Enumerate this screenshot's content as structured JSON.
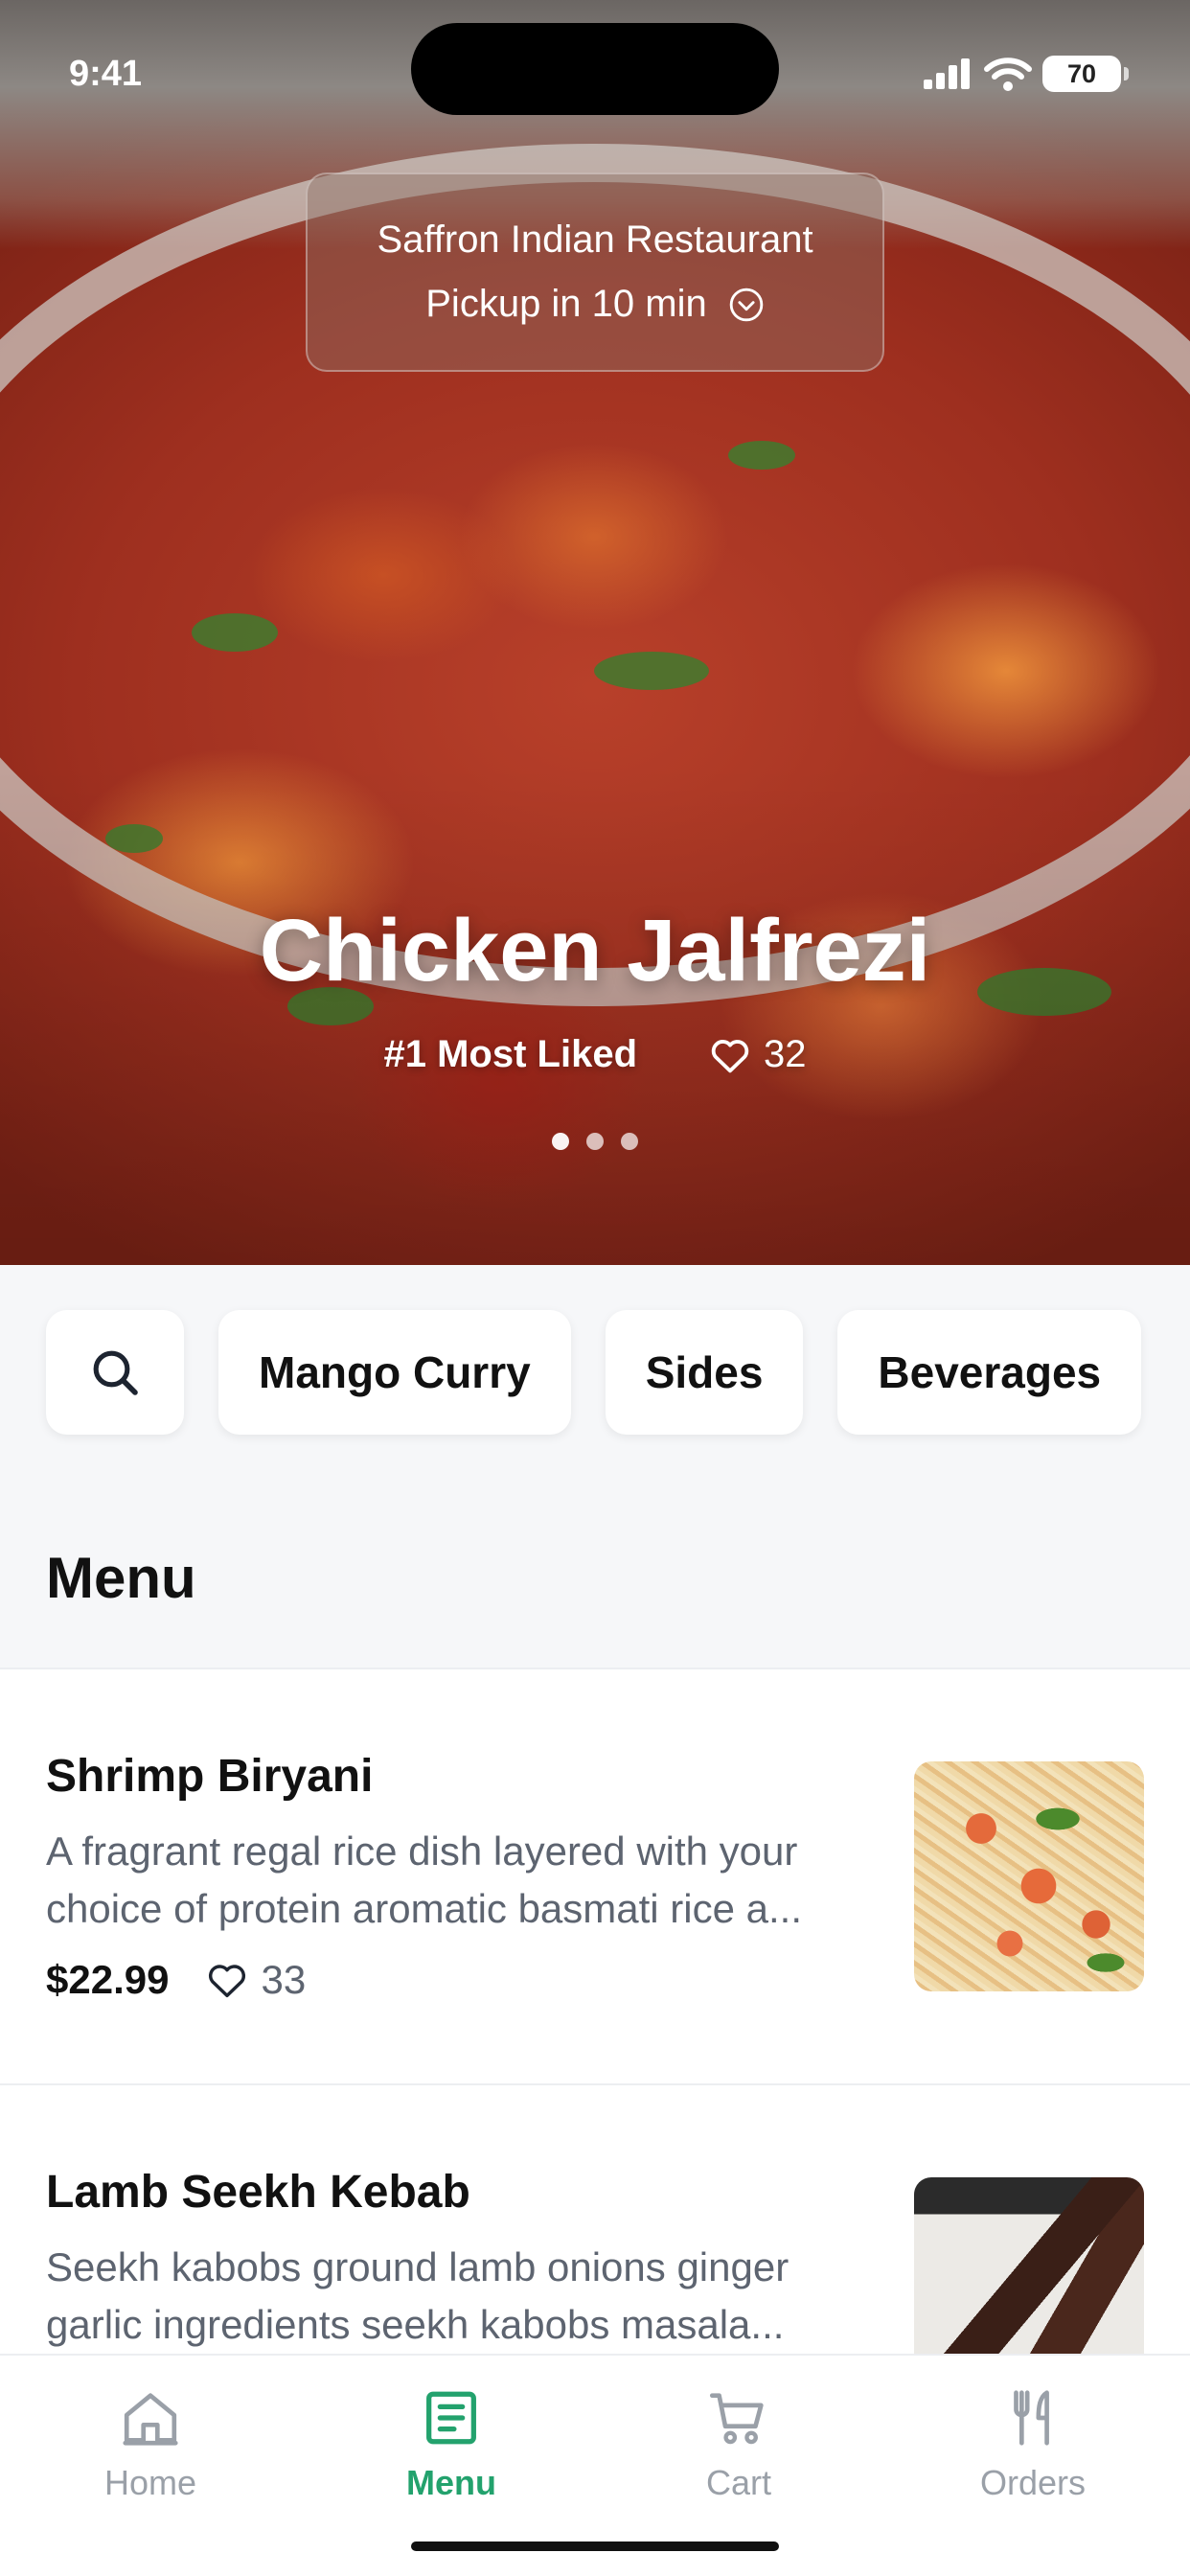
{
  "status_bar": {
    "time": "9:41",
    "battery": "70"
  },
  "restaurant": {
    "name": "Saffron Indian Restaurant",
    "pickup": "Pickup in 10 min"
  },
  "hero": {
    "title": "Chicken Jalfrezi",
    "badge": "#1 Most Liked",
    "likes": "32",
    "slide_count": 3,
    "active_slide": 0
  },
  "categories": [
    "Mango Curry",
    "Sides",
    "Beverages"
  ],
  "menu": {
    "title": "Menu",
    "items": [
      {
        "name": "Shrimp Biryani",
        "desc_line1": "A fragrant regal rice dish layered with your",
        "desc_line2": "choice of protein aromatic basmati rice a...",
        "price": "$22.99",
        "likes": "33",
        "image": "shrimp-biryani-photo"
      },
      {
        "name": "Lamb Seekh Kebab",
        "desc_line1": "Seekh kabobs ground lamb onions ginger",
        "desc_line2": "garlic ingredients seekh kabobs masala...",
        "image": "lamb-seekh-kebab-photo"
      }
    ]
  },
  "tabs": [
    {
      "label": "Home",
      "icon": "house-icon",
      "active": false
    },
    {
      "label": "Menu",
      "icon": "menu-list-icon",
      "active": true
    },
    {
      "label": "Cart",
      "icon": "cart-icon",
      "active": false
    },
    {
      "label": "Orders",
      "icon": "fork-knife-icon",
      "active": false
    }
  ],
  "colors": {
    "accent": "#23a26d",
    "inactive_tab": "#9aa0a8",
    "text_primary": "#111111",
    "text_secondary": "#5d6470"
  }
}
